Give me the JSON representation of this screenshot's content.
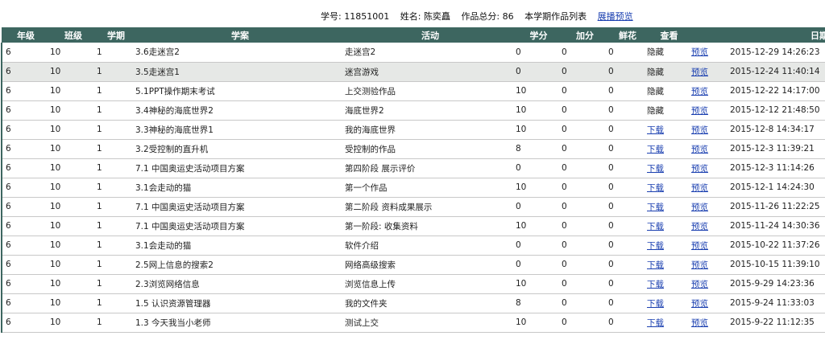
{
  "header": {
    "student_id_label": "学号:",
    "student_id": "11851001",
    "name_label": "姓名:",
    "name": "陈奕矗",
    "total_label": "作品总分:",
    "total": "86",
    "list_title": "本学期作品列表",
    "preview_link": "展播预览"
  },
  "columns": [
    "年级",
    "班级",
    "学期",
    "学案",
    "活动",
    "学分",
    "加分",
    "鲜花",
    "查看",
    "",
    "日期"
  ],
  "rows": [
    {
      "grade": "6",
      "cls": "10",
      "term": "1",
      "plan": "3.6走迷宫2",
      "activity": "走迷宫2",
      "score": "0",
      "bonus": "0",
      "flowers": "0",
      "view": "隐藏",
      "view_link": false,
      "preview": "预览",
      "date": "2015-12-29 14:26:23"
    },
    {
      "grade": "6",
      "cls": "10",
      "term": "1",
      "plan": "3.5走迷宫1",
      "activity": "迷宫游戏",
      "score": "0",
      "bonus": "0",
      "flowers": "0",
      "view": "隐藏",
      "view_link": false,
      "preview": "预览",
      "date": "2015-12-24 11:40:14"
    },
    {
      "grade": "6",
      "cls": "10",
      "term": "1",
      "plan": "5.1PPT操作期末考试",
      "activity": "上交测验作品",
      "score": "10",
      "bonus": "0",
      "flowers": "0",
      "view": "隐藏",
      "view_link": false,
      "preview": "预览",
      "date": "2015-12-22 14:17:00"
    },
    {
      "grade": "6",
      "cls": "10",
      "term": "1",
      "plan": "3.4神秘的海底世界2",
      "activity": "海底世界2",
      "score": "10",
      "bonus": "0",
      "flowers": "0",
      "view": "隐藏",
      "view_link": false,
      "preview": "预览",
      "date": "2015-12-12 21:48:50"
    },
    {
      "grade": "6",
      "cls": "10",
      "term": "1",
      "plan": "3.3神秘的海底世界1",
      "activity": "我的海底世界",
      "score": "10",
      "bonus": "0",
      "flowers": "0",
      "view": "下载",
      "view_link": true,
      "preview": "预览",
      "date": "2015-12-8 14:34:17"
    },
    {
      "grade": "6",
      "cls": "10",
      "term": "1",
      "plan": "3.2受控制的直升机",
      "activity": "受控制的作品",
      "score": "8",
      "bonus": "0",
      "flowers": "0",
      "view": "下载",
      "view_link": true,
      "preview": "预览",
      "date": "2015-12-3 11:39:21"
    },
    {
      "grade": "6",
      "cls": "10",
      "term": "1",
      "plan": "7.1 中国奥运史活动项目方案",
      "activity": "第四阶段 展示评价",
      "score": "0",
      "bonus": "0",
      "flowers": "0",
      "view": "下载",
      "view_link": true,
      "preview": "预览",
      "date": "2015-12-3 11:14:26"
    },
    {
      "grade": "6",
      "cls": "10",
      "term": "1",
      "plan": "3.1会走动的猫",
      "activity": "第一个作品",
      "score": "10",
      "bonus": "0",
      "flowers": "0",
      "view": "下载",
      "view_link": true,
      "preview": "预览",
      "date": "2015-12-1 14:24:30"
    },
    {
      "grade": "6",
      "cls": "10",
      "term": "1",
      "plan": "7.1 中国奥运史活动项目方案",
      "activity": "第二阶段 资料成果展示",
      "score": "0",
      "bonus": "0",
      "flowers": "0",
      "view": "下载",
      "view_link": true,
      "preview": "预览",
      "date": "2015-11-26 11:22:25"
    },
    {
      "grade": "6",
      "cls": "10",
      "term": "1",
      "plan": "7.1 中国奥运史活动项目方案",
      "activity": "第一阶段: 收集资料",
      "score": "10",
      "bonus": "0",
      "flowers": "0",
      "view": "下载",
      "view_link": true,
      "preview": "预览",
      "date": "2015-11-24 14:30:36"
    },
    {
      "grade": "6",
      "cls": "10",
      "term": "1",
      "plan": "3.1会走动的猫",
      "activity": "软件介绍",
      "score": "0",
      "bonus": "0",
      "flowers": "0",
      "view": "下载",
      "view_link": true,
      "preview": "预览",
      "date": "2015-10-22 11:37:26"
    },
    {
      "grade": "6",
      "cls": "10",
      "term": "1",
      "plan": "2.5网上信息的搜索2",
      "activity": "网络高级搜索",
      "score": "0",
      "bonus": "0",
      "flowers": "0",
      "view": "下载",
      "view_link": true,
      "preview": "预览",
      "date": "2015-10-15 11:39:10"
    },
    {
      "grade": "6",
      "cls": "10",
      "term": "1",
      "plan": "2.3浏览网络信息",
      "activity": "浏览信息上传",
      "score": "10",
      "bonus": "0",
      "flowers": "0",
      "view": "下载",
      "view_link": true,
      "preview": "预览",
      "date": "2015-9-29 14:23:36"
    },
    {
      "grade": "6",
      "cls": "10",
      "term": "1",
      "plan": "1.5 认识资源管理器",
      "activity": "我的文件夹",
      "score": "8",
      "bonus": "0",
      "flowers": "0",
      "view": "下载",
      "view_link": true,
      "preview": "预览",
      "date": "2015-9-24 11:33:03"
    },
    {
      "grade": "6",
      "cls": "10",
      "term": "1",
      "plan": "1.3 今天我当小老师",
      "activity": "测试上交",
      "score": "10",
      "bonus": "0",
      "flowers": "0",
      "view": "下载",
      "view_link": true,
      "preview": "预览",
      "date": "2015-9-22 11:12:35"
    }
  ],
  "colors": {
    "header_bg": "#3d6660",
    "link": "#1a3fb0",
    "highlight_row": "#e6e8e6"
  }
}
